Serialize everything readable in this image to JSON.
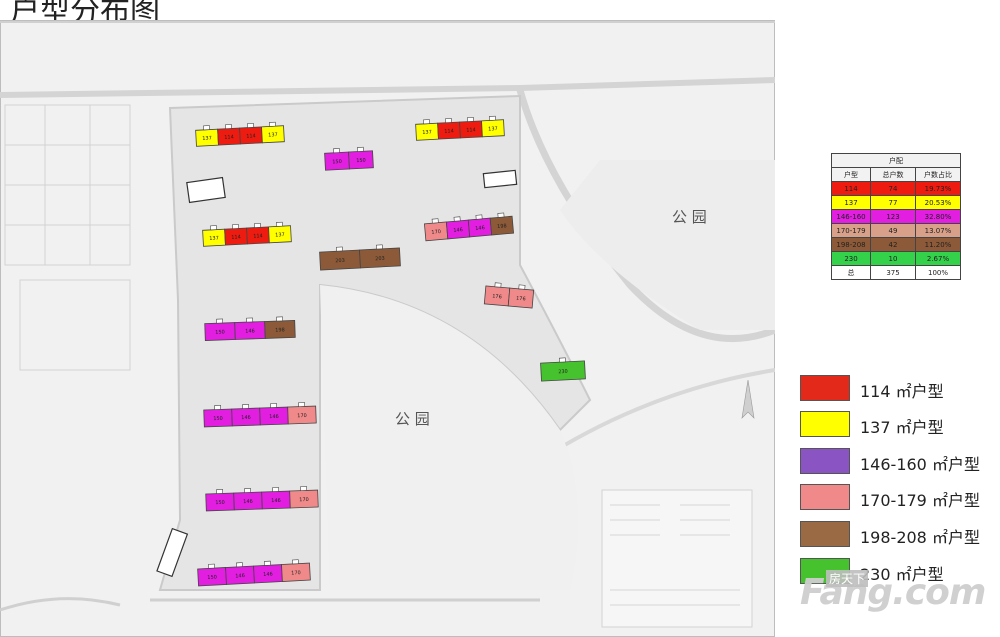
{
  "title": "户型分布图",
  "park_labels": [
    "公 园",
    "公 园"
  ],
  "table": {
    "title": "户配",
    "headers": [
      "户型",
      "总户数",
      "户数占比"
    ],
    "rows": [
      {
        "type": "114",
        "count": "74",
        "ratio": "19.73%",
        "color": "#ee1c10"
      },
      {
        "type": "137",
        "count": "77",
        "ratio": "20.53%",
        "color": "#ffff00"
      },
      {
        "type": "146-160",
        "count": "123",
        "ratio": "32.80%",
        "color": "#e21ee0"
      },
      {
        "type": "170-179",
        "count": "49",
        "ratio": "13.07%",
        "color": "#d8a089"
      },
      {
        "type": "198-208",
        "count": "42",
        "ratio": "11.20%",
        "color": "#8c5a38"
      },
      {
        "type": "230",
        "count": "10",
        "ratio": "2.67%",
        "color": "#34d14a"
      },
      {
        "type": "总",
        "count": "375",
        "ratio": "100%",
        "color": "#ffffff"
      }
    ]
  },
  "legend": [
    {
      "label": "114 ㎡户型",
      "color": "#e32a1a"
    },
    {
      "label": "137 ㎡户型",
      "color": "#ffff00"
    },
    {
      "label": "146-160 ㎡户型",
      "color": "#8a55c2"
    },
    {
      "label": "170-179 ㎡户型",
      "color": "#f08a8a"
    },
    {
      "label": "198-208 ㎡户型",
      "color": "#9a6a45"
    },
    {
      "label": "230 ㎡户型",
      "color": "#46c22e"
    }
  ],
  "buildings": [
    {
      "units": [
        [
          "137",
          "#ffff00"
        ],
        [
          "114",
          "#ee1c10"
        ],
        [
          "114",
          "#ee1c10"
        ],
        [
          "137",
          "#ffff00"
        ]
      ]
    },
    {
      "units": [
        [
          "137",
          "#ffff00"
        ],
        [
          "114",
          "#ee1c10"
        ],
        [
          "114",
          "#ee1c10"
        ],
        [
          "137",
          "#ffff00"
        ]
      ]
    },
    {
      "units": [
        [
          "150",
          "#e21ee0"
        ],
        [
          "150",
          "#e21ee0"
        ]
      ]
    },
    {
      "units": [
        [
          "137",
          "#ffff00"
        ],
        [
          "114",
          "#ee1c10"
        ],
        [
          "114",
          "#ee1c10"
        ],
        [
          "137",
          "#ffff00"
        ]
      ]
    },
    {
      "units": [
        [
          "203",
          "#8c5a38"
        ],
        [
          "203",
          "#8c5a38"
        ]
      ]
    },
    {
      "units": [
        [
          "170",
          "#f08a8a"
        ],
        [
          "146",
          "#e21ee0"
        ],
        [
          "146",
          "#e21ee0"
        ],
        [
          "198",
          "#8c5a38"
        ]
      ]
    },
    {
      "units": [
        [
          "176",
          "#f08a8a"
        ],
        [
          "176",
          "#f08a8a"
        ]
      ]
    },
    {
      "units": [
        [
          "150",
          "#e21ee0"
        ],
        [
          "146",
          "#e21ee0"
        ],
        [
          "198",
          "#8c5a38"
        ]
      ]
    },
    {
      "units": [
        [
          "230",
          "#46c22e"
        ]
      ]
    },
    {
      "units": [
        [
          "150",
          "#e21ee0"
        ],
        [
          "146",
          "#e21ee0"
        ],
        [
          "146",
          "#e21ee0"
        ],
        [
          "170",
          "#f08a8a"
        ]
      ]
    },
    {
      "units": [
        [
          "150",
          "#e21ee0"
        ],
        [
          "146",
          "#e21ee0"
        ],
        [
          "146",
          "#e21ee0"
        ],
        [
          "170",
          "#f08a8a"
        ]
      ]
    },
    {
      "units": [
        [
          "150",
          "#e21ee0"
        ],
        [
          "146",
          "#e21ee0"
        ],
        [
          "146",
          "#e21ee0"
        ],
        [
          "170",
          "#f08a8a"
        ]
      ]
    }
  ],
  "watermark": {
    "text": "Fang.com",
    "sub": "房天下"
  }
}
